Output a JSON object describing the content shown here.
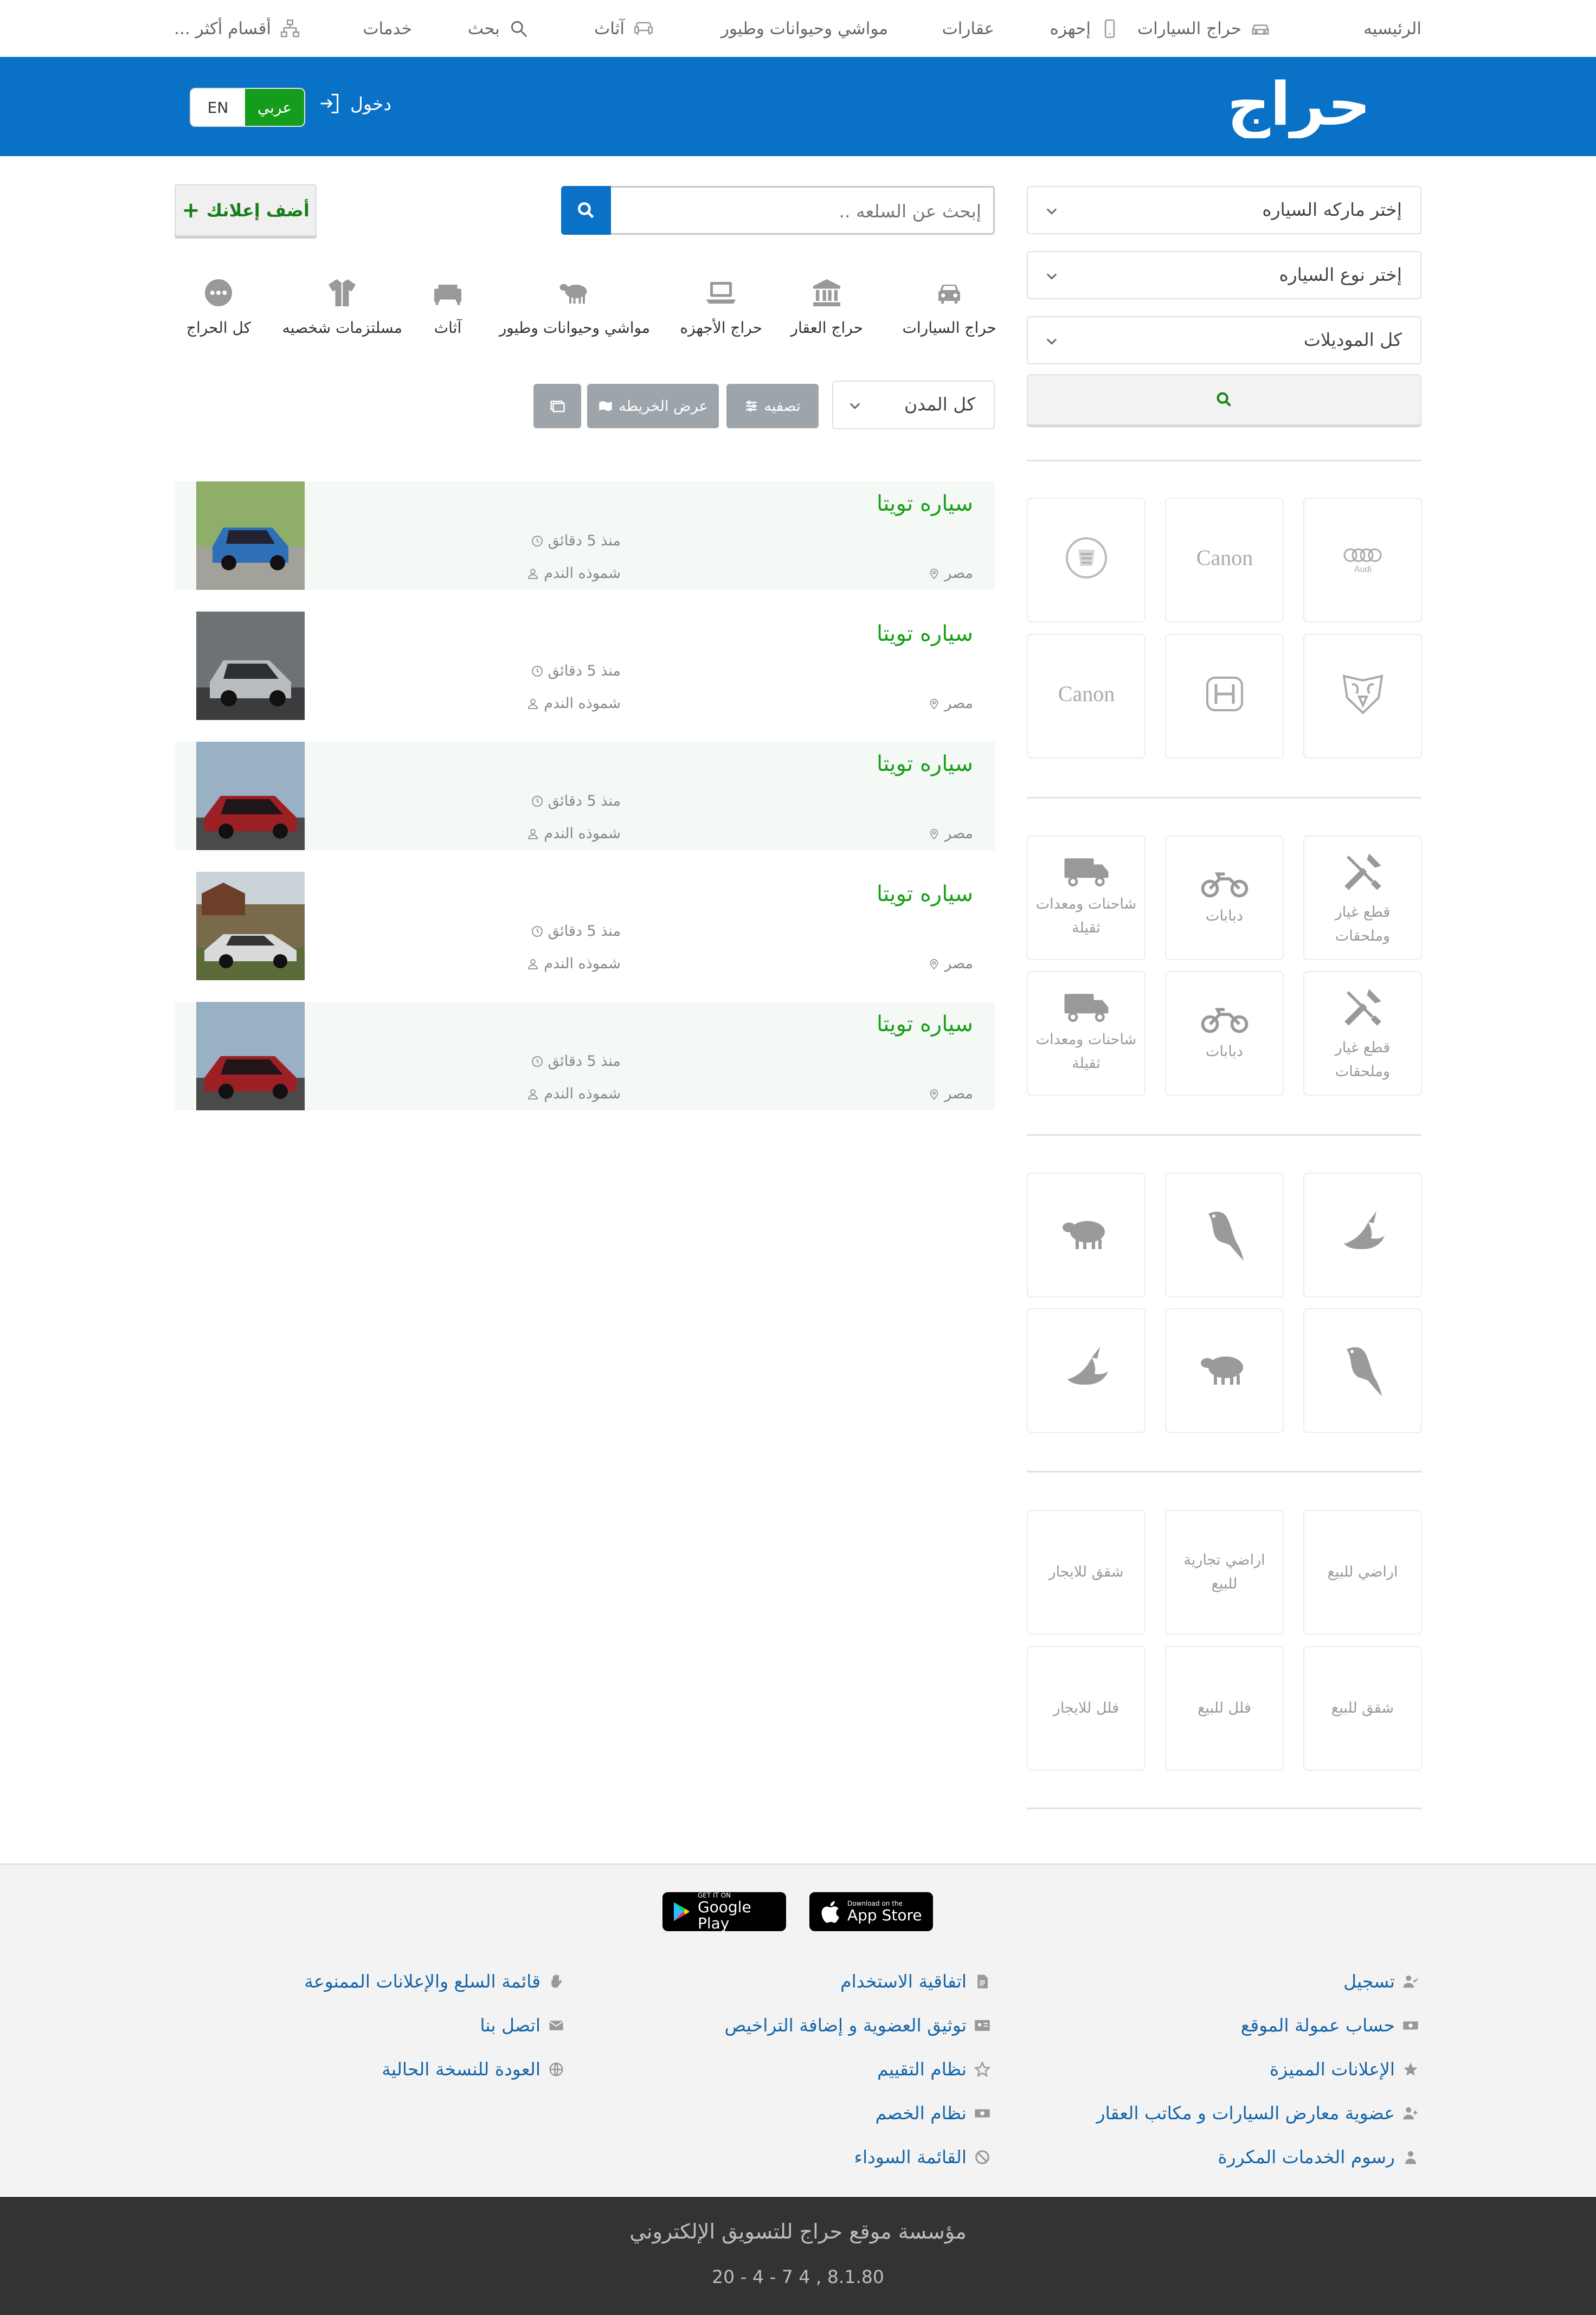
{
  "topnav": {
    "items": [
      {
        "label": "الرئيسيه",
        "icon": ""
      },
      {
        "label": "حراج السيارات",
        "icon": "car-icon"
      },
      {
        "label": "إحهزه",
        "icon": "phone-icon"
      },
      {
        "label": "عقارات",
        "icon": ""
      },
      {
        "label": "مواشي وحيوانات وطيور",
        "icon": ""
      },
      {
        "label": "آثاث",
        "icon": "sofa-icon"
      },
      {
        "label": "بحث",
        "icon": "search-icon"
      },
      {
        "label": "خدمات",
        "icon": ""
      },
      {
        "label": "أقسام أكثر ...",
        "icon": "sitemap-icon"
      }
    ]
  },
  "header": {
    "logo": "حراج",
    "login_label": "دخول",
    "lang_ar": "عربي",
    "lang_en": "EN",
    "brand_color": "#0a72c6"
  },
  "sidebar": {
    "select_brand": "إختر ماركه السياره",
    "select_type": "إختر نوع السياره",
    "select_model": "كل الموديلات",
    "brand_tiles": [
      "audi-logo",
      "canon-logo",
      "cadillac-logo",
      "ram-logo",
      "honda-logo",
      "canon-logo"
    ],
    "brand_text": {
      "audi": "Audi",
      "canon1": "Canon",
      "canon2": "Canon"
    },
    "vehicle_tiles": [
      "قطع غيار وملحقات",
      "دبابات",
      "شاحنات ومعدات ثقيلة",
      "قطع غيار وملحقات",
      "دبابات",
      "شاحنات ومعدات ثقيلة"
    ],
    "animal_tiles": [
      "bird-icon",
      "parrot-icon",
      "sheep-icon",
      "parrot-icon",
      "sheep-icon",
      "bird-icon"
    ],
    "realestate_tiles": [
      "اراضي للبيع",
      "اراضي تجارية للبيع",
      "شقق للايجار",
      "شقق للبيع",
      "فلل للبيع",
      "فلل للايجار"
    ]
  },
  "search": {
    "placeholder": "إبحث عن السلعه ..",
    "add_ad_label": "أضف إعلانك"
  },
  "categories": [
    {
      "label": "حراج السيارات",
      "icon": "car-icon"
    },
    {
      "label": "حراج العقار",
      "icon": "bank-icon"
    },
    {
      "label": "حراج الأجهزه",
      "icon": "laptop-icon"
    },
    {
      "label": "مواشي وحيوانات وطيور",
      "icon": "sheep-icon"
    },
    {
      "label": "آثاث",
      "icon": "sofa-icon"
    },
    {
      "label": "مسلتزمات شخصيه",
      "icon": "shirt-icon"
    },
    {
      "label": "كل الحراج",
      "icon": "more-icon"
    }
  ],
  "filters": {
    "city": "كل المدن",
    "filter_label": "تصفيه",
    "map_label": "عرض الخريطه"
  },
  "listings": [
    {
      "title": "سياره تويتا",
      "time": "منذ 5 دقائق",
      "user": "شموذه الندم",
      "location": "مصر",
      "car_color": "#2f6fb8",
      "bg": "#8fae6a"
    },
    {
      "title": "سياره تويتا",
      "time": "منذ 5 دقائق",
      "user": "شموذه الندم",
      "location": "مصر",
      "car_color": "#b9bcbe",
      "bg": "#6f7274"
    },
    {
      "title": "سياره تويتا",
      "time": "منذ 5 دقائق",
      "user": "شموذه الندم",
      "location": "مصر",
      "car_color": "#9c1f24",
      "bg": "#9ab0c4"
    },
    {
      "title": "سياره تويتا",
      "time": "منذ 5 دقائق",
      "user": "شموذه الندم",
      "location": "مصر",
      "car_color": "#d7d9da",
      "bg": "#7a6a4c"
    },
    {
      "title": "سياره تويتا",
      "time": "منذ 5 دقائق",
      "user": "شموذه الندم",
      "location": "مصر",
      "car_color": "#9c1f24",
      "bg": "#9ab0c4"
    }
  ],
  "footer": {
    "app_store_small": "Download on the",
    "app_store_big": "App Store",
    "google_small": "GET IT ON",
    "google_big": "Google Play",
    "col1": [
      {
        "label": "تسجيل",
        "icon": "user-check-icon"
      },
      {
        "label": "حساب عمولة الموقع",
        "icon": "money-icon"
      },
      {
        "label": "الإعلانات المميزة",
        "icon": "star-icon"
      },
      {
        "label": "عضوية معارض السيارات و مكاتب العقار",
        "icon": "user-plus-icon"
      },
      {
        "label": "رسوم الخدمات المكررة",
        "icon": "user-tie-icon"
      }
    ],
    "col2": [
      {
        "label": "اتفاقية الاستخدام",
        "icon": "file-icon"
      },
      {
        "label": "توثيق العضوية و إضافة التراخيص",
        "icon": "id-card-icon"
      },
      {
        "label": "نظام التقييم",
        "icon": "star-half-icon"
      },
      {
        "label": "نظام الخصم",
        "icon": "money-icon"
      },
      {
        "label": "القائمة السوداء",
        "icon": "ban-icon"
      }
    ],
    "col3": [
      {
        "label": "قائمة السلع والإعلانات الممنوعة",
        "icon": "hand-icon"
      },
      {
        "label": "اتصل بنا",
        "icon": "envelope-icon"
      },
      {
        "label": "العودة للنسخة الحالية",
        "icon": "globe-icon"
      }
    ],
    "company": "مؤسسة موقع حراج للتسويق الإلكتروني",
    "version": "20 - 4 - 7 4 , 8.1.80"
  }
}
